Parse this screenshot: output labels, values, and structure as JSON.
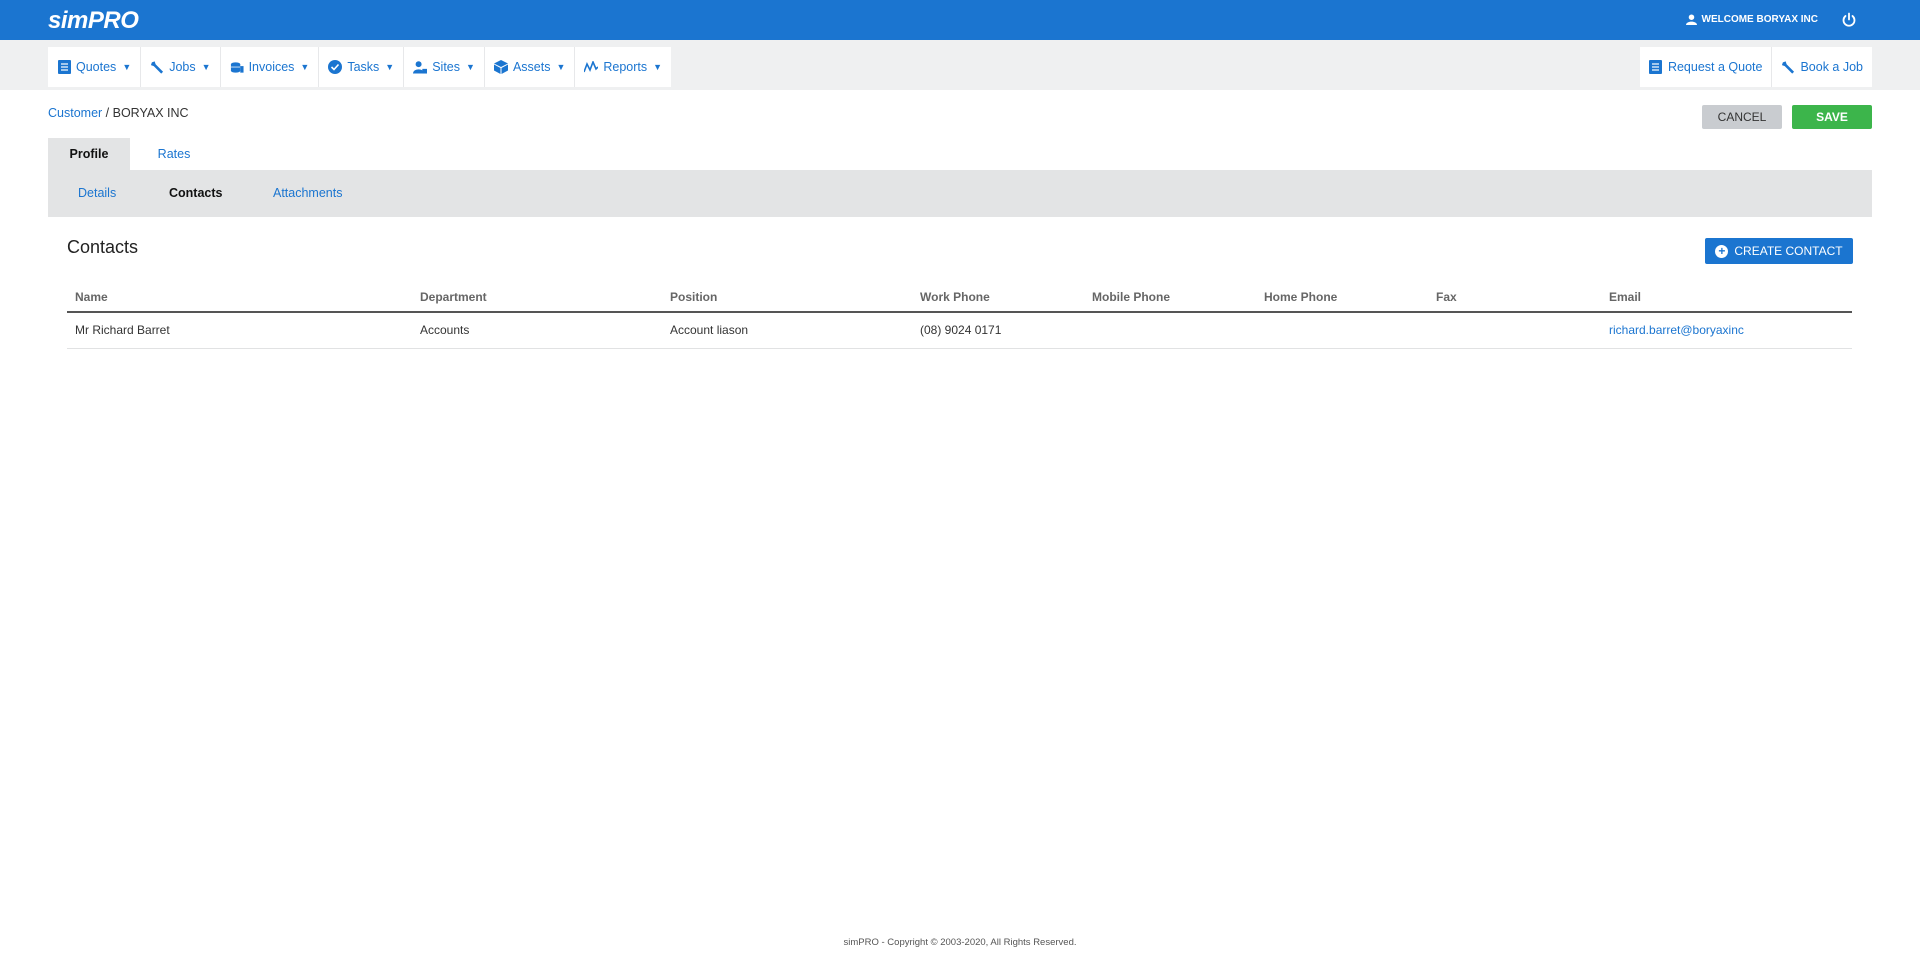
{
  "app": {
    "logo_text": "simPRO",
    "welcome": "WELCOME BORYAX INC"
  },
  "nav": {
    "left": [
      {
        "label": "Quotes",
        "icon": "document-icon"
      },
      {
        "label": "Jobs",
        "icon": "wrench-icon"
      },
      {
        "label": "Invoices",
        "icon": "coins-icon"
      },
      {
        "label": "Tasks",
        "icon": "check-circle-icon"
      },
      {
        "label": "Sites",
        "icon": "site-user-icon"
      },
      {
        "label": "Assets",
        "icon": "cube-icon"
      },
      {
        "label": "Reports",
        "icon": "chart-icon"
      }
    ],
    "right": [
      {
        "label": "Request a Quote",
        "icon": "document-icon"
      },
      {
        "label": "Book a Job",
        "icon": "wrench-icon"
      }
    ]
  },
  "breadcrumb": {
    "link": "Customer",
    "separator": " / ",
    "current": "BORYAX INC"
  },
  "actions": {
    "cancel": "CANCEL",
    "save": "SAVE"
  },
  "tabs": {
    "profile": "Profile",
    "rates": "Rates"
  },
  "subtabs": {
    "details": "Details",
    "contacts": "Contacts",
    "attachments": "Attachments"
  },
  "contacts": {
    "title": "Contacts",
    "create_label": "CREATE CONTACT",
    "columns": [
      "Name",
      "Department",
      "Position",
      "Work Phone",
      "Mobile Phone",
      "Home Phone",
      "Fax",
      "Email"
    ],
    "rows": [
      [
        "Mr Richard Barret",
        "Accounts",
        "Account liason",
        "(08) 9024 0171",
        "",
        "",
        "",
        "richard.barret@boryaxinc"
      ]
    ]
  },
  "footer": "simPRO - Copyright © 2003-2020, All Rights Reserved.",
  "colors": {
    "brand": "#1b75d0",
    "save": "#3cb54b",
    "cancel": "#c9ccd0"
  }
}
